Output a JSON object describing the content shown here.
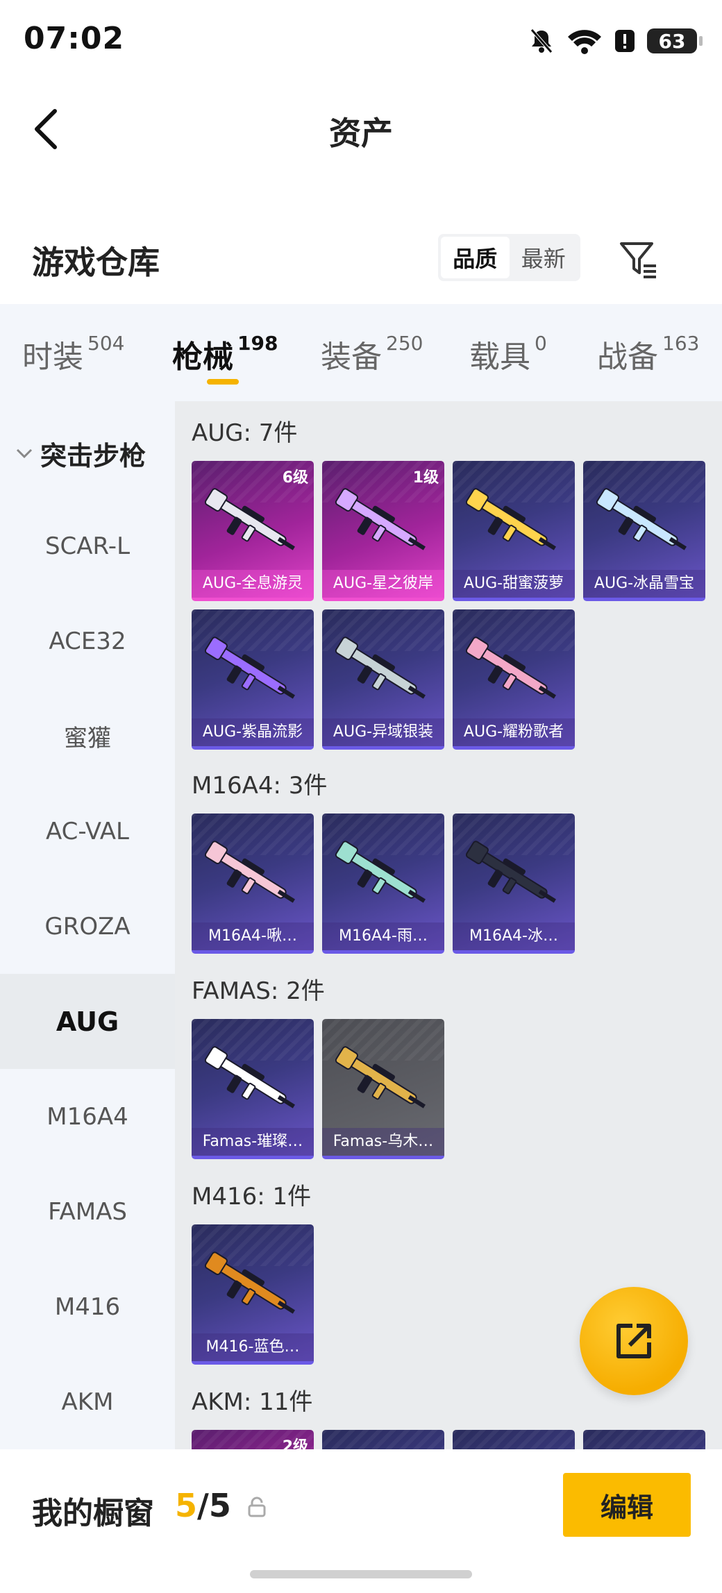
{
  "status_bar": {
    "time": "07:02",
    "battery": "63"
  },
  "nav": {
    "title": "资产"
  },
  "warehouse": {
    "title": "游戏仓库",
    "sort_options": [
      "品质",
      "最新"
    ],
    "sort_selected": "品质"
  },
  "tabs": [
    {
      "label": "时装",
      "count": "504"
    },
    {
      "label": "枪械",
      "count": "198"
    },
    {
      "label": "装备",
      "count": "250"
    },
    {
      "label": "载具",
      "count": "0"
    },
    {
      "label": "战备",
      "count": "163"
    }
  ],
  "sidebar": {
    "group": "突击步枪",
    "items": [
      "SCAR-L",
      "ACE32",
      "蜜獾",
      "AC-VAL",
      "GROZA",
      "AUG",
      "M16A4",
      "FAMAS",
      "M416",
      "AKM"
    ],
    "selected": "AUG"
  },
  "sections": [
    {
      "title": "AUG: 7件",
      "items": [
        {
          "name": "AUG-全息游灵",
          "level": "6级",
          "rarity": "pink"
        },
        {
          "name": "AUG-星之彼岸",
          "level": "1级",
          "rarity": "pink"
        },
        {
          "name": "AUG-甜蜜菠萝",
          "level": "",
          "rarity": "purple"
        },
        {
          "name": "AUG-冰晶雪宝",
          "level": "",
          "rarity": "purple"
        },
        {
          "name": "AUG-紫晶流影",
          "level": "",
          "rarity": "purple"
        },
        {
          "name": "AUG-异域银装",
          "level": "",
          "rarity": "purple"
        },
        {
          "name": "AUG-耀粉歌者",
          "level": "",
          "rarity": "purple"
        }
      ]
    },
    {
      "title": "M16A4: 3件",
      "items": [
        {
          "name": "M16A4-啾…",
          "level": "",
          "rarity": "purple"
        },
        {
          "name": "M16A4-雨…",
          "level": "",
          "rarity": "purple"
        },
        {
          "name": "M16A4-冰…",
          "level": "",
          "rarity": "purple"
        }
      ]
    },
    {
      "title": "FAMAS: 2件",
      "items": [
        {
          "name": "Famas-璀璨…",
          "level": "",
          "rarity": "purple"
        },
        {
          "name": "Famas-乌木…",
          "level": "",
          "rarity": "grey"
        }
      ]
    },
    {
      "title": "M416: 1件",
      "items": [
        {
          "name": "M416-蓝色…",
          "level": "",
          "rarity": "purple"
        }
      ]
    },
    {
      "title": "AKM: 11件",
      "items": [
        {
          "name": "",
          "level": "2级",
          "rarity": "pink"
        },
        {
          "name": "",
          "level": "",
          "rarity": "purple"
        },
        {
          "name": "",
          "level": "",
          "rarity": "purple"
        },
        {
          "name": "",
          "level": "",
          "rarity": "purple"
        }
      ]
    }
  ],
  "bottom_bar": {
    "label": "我的橱窗",
    "current": "5",
    "total": "/5",
    "edit_label": "编辑"
  },
  "colors": {
    "accent": "#f5b300",
    "card_purple": "#3b3a82",
    "card_pink": "#a0249a"
  }
}
